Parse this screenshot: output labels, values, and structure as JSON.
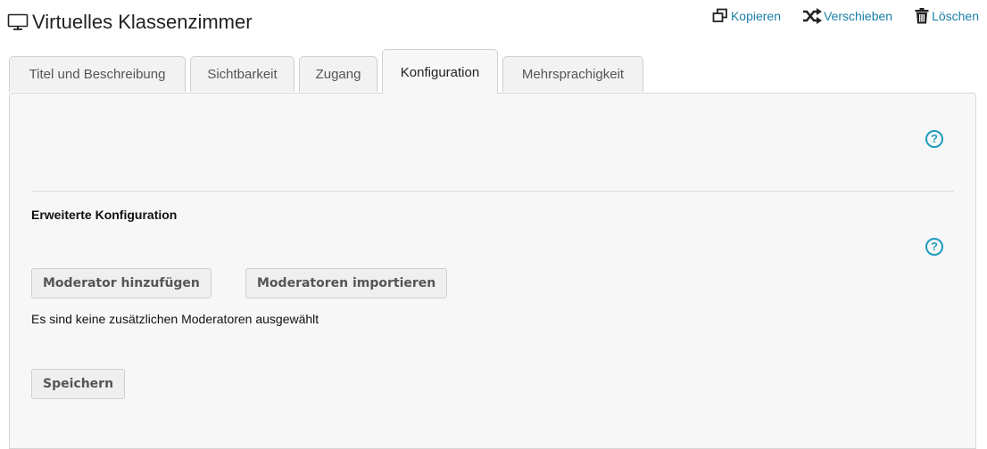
{
  "header": {
    "icon": "monitor-icon",
    "title": "Virtuelles Klassenzimmer"
  },
  "actions": [
    {
      "label": "Kopieren",
      "icon": "copy-icon"
    },
    {
      "label": "Verschieben",
      "icon": "shuffle-icon"
    },
    {
      "label": "Löschen",
      "icon": "trash-icon"
    }
  ],
  "tabs": [
    {
      "label": "Titel und Beschreibung",
      "active": false
    },
    {
      "label": "Sichtbarkeit",
      "active": false
    },
    {
      "label": "Zugang",
      "active": false
    },
    {
      "label": "Konfiguration",
      "active": true
    },
    {
      "label": "Mehrsprachigkeit",
      "active": false
    }
  ],
  "panel": {
    "help_icon": "help-circle-icon",
    "section_title": "Erweiterte Konfiguration",
    "buttons": {
      "add_moderator": "Moderator hinzufügen",
      "import_moderators": "Moderatoren importieren",
      "save": "Speichern"
    },
    "no_moderators_text": "Es sind keine zusätzlichen Moderatoren ausgewählt"
  },
  "colors": {
    "link": "#1a7fa6",
    "help": "#1f9bbf",
    "panel_bg": "#f7f7f7"
  }
}
